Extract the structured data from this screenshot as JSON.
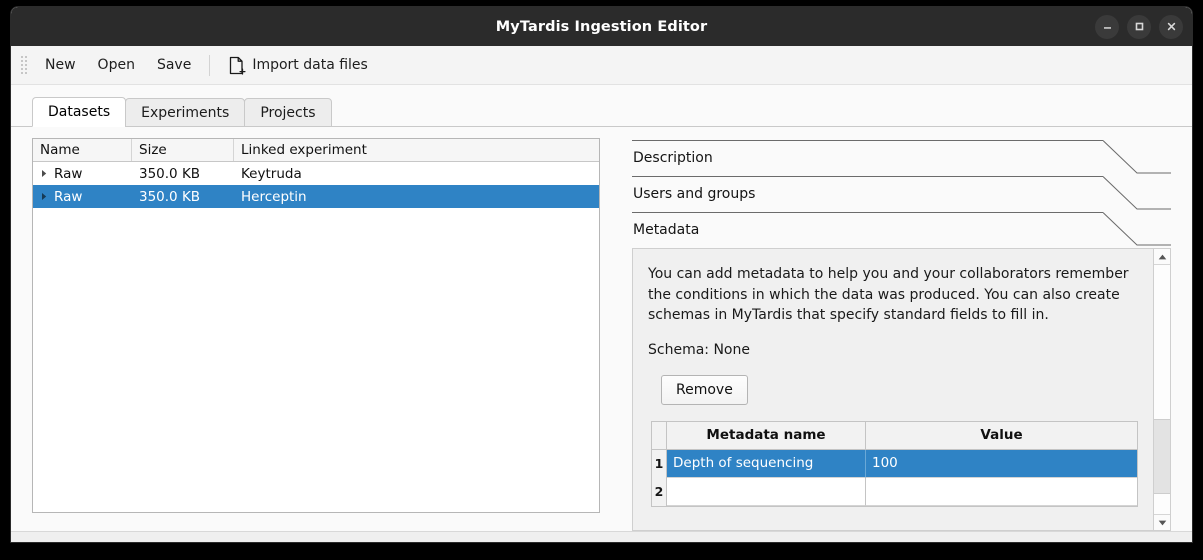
{
  "window": {
    "title": "MyTardis Ingestion Editor",
    "controls": [
      {
        "name": "minimize-button",
        "glyph": "minimize"
      },
      {
        "name": "maximize-button",
        "glyph": "maximize"
      },
      {
        "name": "close-button",
        "glyph": "close"
      }
    ]
  },
  "toolbar": {
    "new_label": "New",
    "open_label": "Open",
    "save_label": "Save",
    "import_label": "Import data files",
    "import_icon": "document-add-icon"
  },
  "tabs": [
    {
      "label": "Datasets",
      "active": true
    },
    {
      "label": "Experiments",
      "active": false
    },
    {
      "label": "Projects",
      "active": false
    }
  ],
  "dataset_table": {
    "columns": [
      "Name",
      "Size",
      "Linked experiment"
    ],
    "rows": [
      {
        "name": "Raw",
        "size": "350.0 KB",
        "linked_experiment": "Keytruda",
        "selected": false,
        "expander": "chevron-right-icon"
      },
      {
        "name": "Raw",
        "size": "350.0 KB",
        "linked_experiment": "Herceptin",
        "selected": true,
        "expander": "chevron-right-icon"
      }
    ]
  },
  "accordion": {
    "sections": [
      {
        "label": "Description",
        "expanded": false
      },
      {
        "label": "Users and groups",
        "expanded": false
      },
      {
        "label": "Metadata",
        "expanded": true
      }
    ]
  },
  "metadata": {
    "description": "You can add metadata to help you and your collaborators remember the conditions in which the data was produced. You can also create schemas in MyTardis that specify standard fields to fill in.",
    "schema_label": "Schema: None",
    "remove_button": "Remove",
    "grid": {
      "columns": [
        "Metadata name",
        "Value"
      ],
      "rows": [
        {
          "index": "1",
          "name": "Depth of sequencing",
          "value": "100",
          "selected": true
        },
        {
          "index": "2",
          "name": "",
          "value": "",
          "selected": false
        }
      ]
    },
    "scrollbar": {
      "up_icon": "triangle-up-icon",
      "down_icon": "triangle-down-icon"
    }
  },
  "colors": {
    "selection_blue": "#2f83c5",
    "titlebar": "#2b2b2b",
    "window_bg": "#fafafa",
    "panel_bg": "#f0f0f0"
  }
}
